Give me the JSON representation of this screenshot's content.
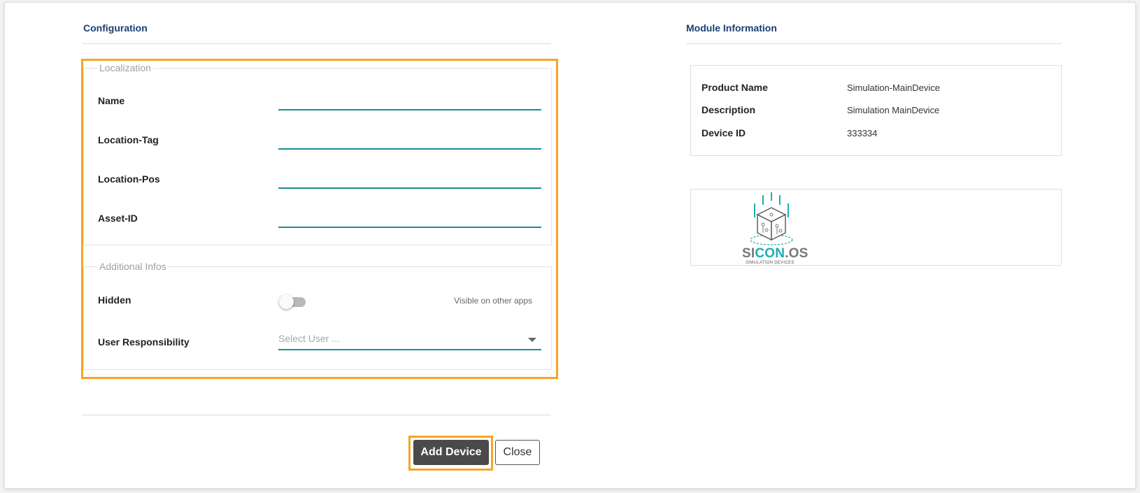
{
  "configuration": {
    "title": "Configuration",
    "localization": {
      "legend": "Localization",
      "fields": [
        {
          "label": "Name",
          "value": ""
        },
        {
          "label": "Location-Tag",
          "value": ""
        },
        {
          "label": "Location-Pos",
          "value": ""
        },
        {
          "label": "Asset-ID",
          "value": ""
        }
      ]
    },
    "additional": {
      "legend": "Additional Infos",
      "hidden_label": "Hidden",
      "hidden_caption": "Visible on other apps",
      "hidden_on": false,
      "user_label": "User Responsibility",
      "user_placeholder": "Select User ..."
    }
  },
  "actions": {
    "add_label": "Add Device",
    "close_label": "Close"
  },
  "module_info": {
    "title": "Module Information",
    "rows": [
      {
        "key": "Product Name",
        "value": "Simulation-MainDevice"
      },
      {
        "key": "Description",
        "value": "Simulation MainDevice"
      },
      {
        "key": "Device ID",
        "value": "333334"
      }
    ],
    "logo": {
      "text_a": "SI",
      "text_b": "CON",
      "text_c": ".OS",
      "subtitle": "SIMULATION DEVICES"
    }
  },
  "colors": {
    "accent_teal": "#1a8e8e",
    "highlight_orange": "#f5a623",
    "title_blue": "#1a3e72"
  }
}
